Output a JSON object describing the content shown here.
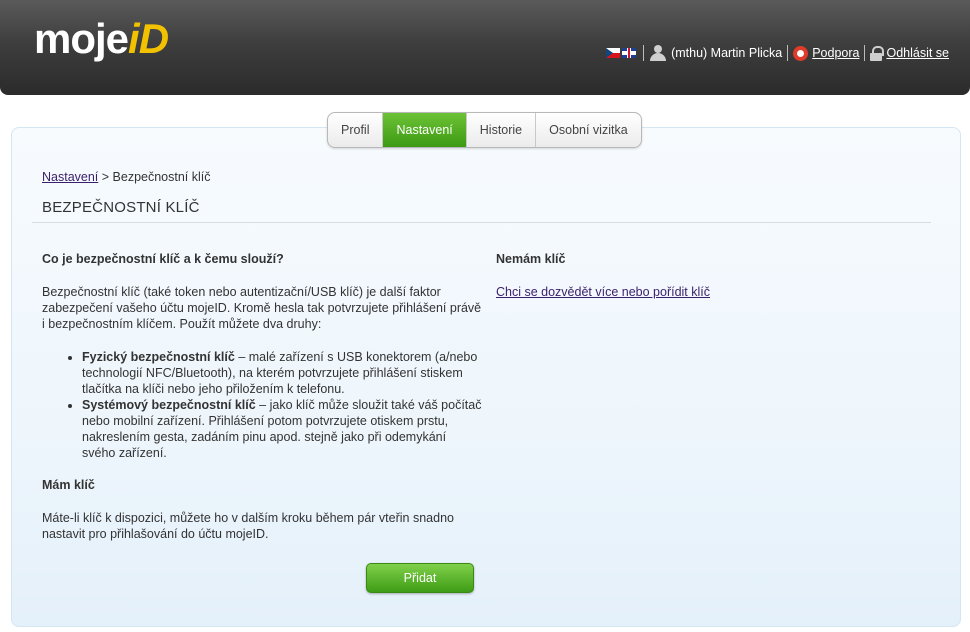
{
  "header": {
    "logo_text_main": "moje",
    "logo_text_id": "iD",
    "user_label": "(mthu) Martin Plicka",
    "support_label": "Podpora",
    "logout_label": "Odhlásit se"
  },
  "tabs": [
    {
      "label": "Profil",
      "active": false
    },
    {
      "label": "Nastavení",
      "active": true
    },
    {
      "label": "Historie",
      "active": false
    },
    {
      "label": "Osobní vizitka",
      "active": false
    }
  ],
  "breadcrumb": {
    "link": "Nastavení",
    "separator": " > ",
    "current": "Bezpečnostní klíč"
  },
  "page_title": "BEZPEČNOSTNÍ KLÍČ",
  "left": {
    "heading_what": "Co je bezpečnostní klíč a k čemu slouží?",
    "intro": "Bezpečnostní klíč (také token nebo autentizační/USB klíč) je další faktor zabezpečení vašeho účtu mojeID. Kromě hesla tak potvrzujete přihlášení právě i bezpečnostním klíčem. Použít můžete dva druhy:",
    "items": [
      {
        "title": "Fyzický bezpečnostní klíč",
        "text": " – malé zařízení s USB konektorem (a/nebo technologií NFC/Bluetooth), na kterém potvrzujete přihlášení stiskem tlačítka na klíči nebo jeho přiložením k telefonu."
      },
      {
        "title": "Systémový bezpečnostní klíč",
        "text": " – jako klíč může sloužit také váš počítač nebo mobilní zařízení. Přihlášení potom potvrzujete otiskem prstu, nakreslením gesta, zadáním pinu apod. stejně jako při odemykání svého zařízení."
      }
    ],
    "heading_have": "Mám klíč",
    "have_text": "Máte-li klíč k dispozici, můžete ho v dalším kroku během pár vteřin snadno nastavit pro přihlašování do účtu mojeID."
  },
  "right": {
    "heading": "Nemám klíč",
    "link": "Chci se dozvědět více nebo pořídit klíč"
  },
  "add_button_label": "Přidat",
  "colors": {
    "accent_green": "#4aa81c",
    "link_purple": "#3a1f6b",
    "header_dark": "#3e3e3e"
  }
}
